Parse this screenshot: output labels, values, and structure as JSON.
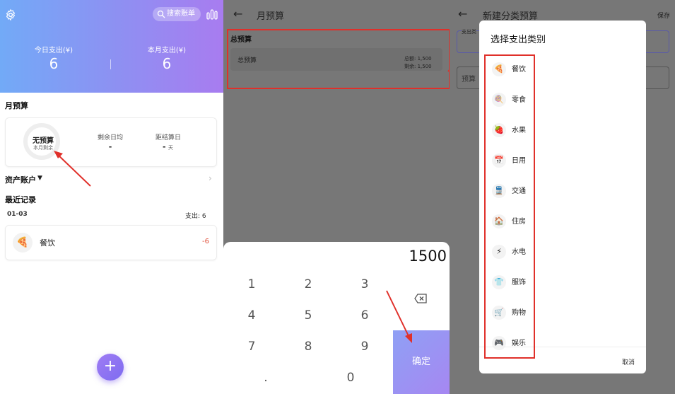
{
  "panel1": {
    "search_label": "搜索账单",
    "today_label": "今日支出(¥)",
    "today_value": "6",
    "month_label": "本月支出(¥)",
    "month_value": "6",
    "budget_title": "月预算",
    "ring_main": "无预算",
    "ring_sub": "本月剩余",
    "avg_label": "剩余日均",
    "avg_value": "-",
    "days_label": "距结算日",
    "days_value": "-",
    "days_unit": "天",
    "assets_label": "资产账户",
    "recent_title": "最近记录",
    "record_date": "01-03",
    "record_total": "支出: 6",
    "record_name": "餐饮",
    "record_amount": "-6",
    "fab_label": "+"
  },
  "panel2": {
    "title": "月预算",
    "section": "总预算",
    "row_label": "总预算",
    "total_line": "总额: 1,500",
    "remain_line": "剩余: 1,500",
    "amount": "1500",
    "keys": [
      "1",
      "2",
      "3",
      "4",
      "5",
      "6",
      "7",
      "8",
      "9",
      ".",
      "0"
    ],
    "confirm": "确定"
  },
  "panel3": {
    "title": "新建分类预算",
    "save": "保存",
    "field1_label": "支出类",
    "field2_label": "预算",
    "dialog_title": "选择支出类别",
    "categories": [
      {
        "icon": "🍕",
        "label": "餐饮"
      },
      {
        "icon": "🍭",
        "label": "零食"
      },
      {
        "icon": "🍓",
        "label": "水果"
      },
      {
        "icon": "📅",
        "label": "日用"
      },
      {
        "icon": "🚆",
        "label": "交通"
      },
      {
        "icon": "🏠",
        "label": "住房"
      },
      {
        "icon": "⚡",
        "label": "水电"
      },
      {
        "icon": "👕",
        "label": "服饰"
      },
      {
        "icon": "🛒",
        "label": "购物"
      },
      {
        "icon": "🎮",
        "label": "娱乐"
      }
    ],
    "cancel": "取消"
  },
  "colors": {
    "accent_gradient_start": "#72aaf7",
    "accent_gradient_end": "#a87cf0",
    "annotation_red": "#e0302a",
    "expense_red": "#e0503a"
  }
}
